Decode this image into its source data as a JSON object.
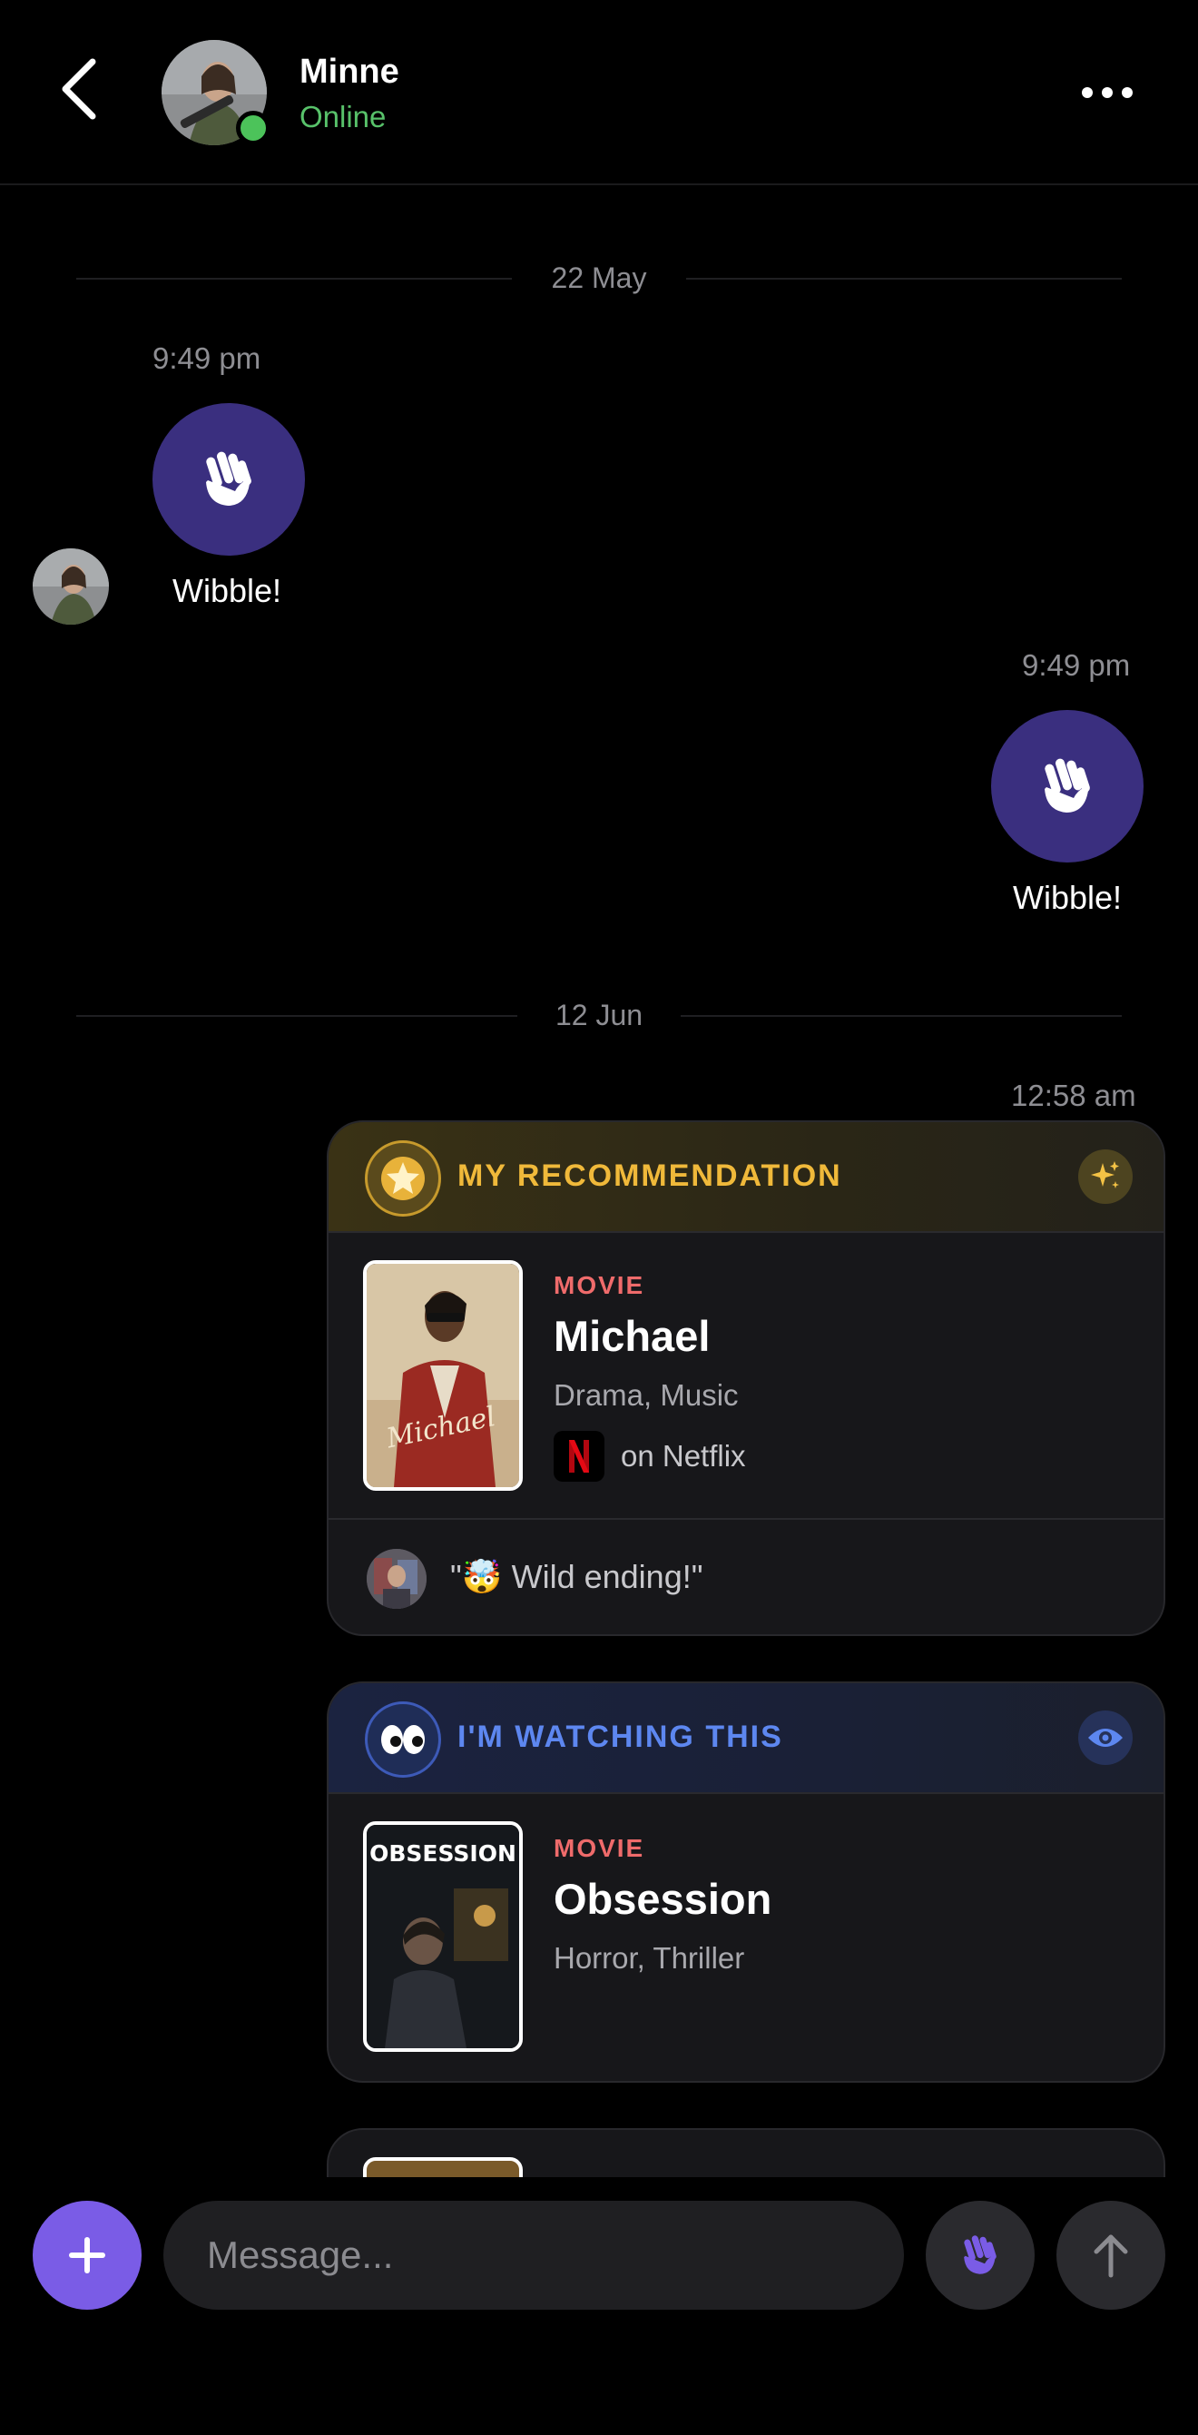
{
  "header": {
    "name": "Minne",
    "status": "Online",
    "status_color": "#58c26a"
  },
  "icons": {
    "back": "chevron-left-icon",
    "more": "ellipsis-icon",
    "wave": "waving-hand-icon",
    "star": "star-icon",
    "sparkle": "sparkle-icon",
    "eyes": "eyes-emoji",
    "eye": "eye-icon",
    "add": "plus-icon",
    "send": "arrow-up-icon"
  },
  "messages": {
    "date1": "22 May",
    "time1": "9:49 pm",
    "wibble1": "Wibble!",
    "time2": "9:49 pm",
    "wibble2": "Wibble!",
    "date2": "12 Jun",
    "time3": "12:58 am"
  },
  "cards": [
    {
      "header": "MY RECOMMENDATION",
      "kind": "MOVIE",
      "title": "Michael",
      "genres": "Drama, Music",
      "service": "on Netflix",
      "poster_text": "Michael",
      "comment": "\"🤯 Wild ending!\"",
      "accent": "#f0b93a"
    },
    {
      "header": "I'M WATCHING THIS",
      "kind": "MOVIE",
      "title": "Obsession",
      "genres": "Horror, Thriller",
      "poster_text": "OBSESSION",
      "accent": "#5d87f0"
    }
  ],
  "composer": {
    "placeholder": "Message..."
  },
  "colors": {
    "background": "#000000",
    "wave_bubble": "#3a2f7f",
    "add_button": "#7a5ce6",
    "movie_label": "#ef6b6b"
  }
}
